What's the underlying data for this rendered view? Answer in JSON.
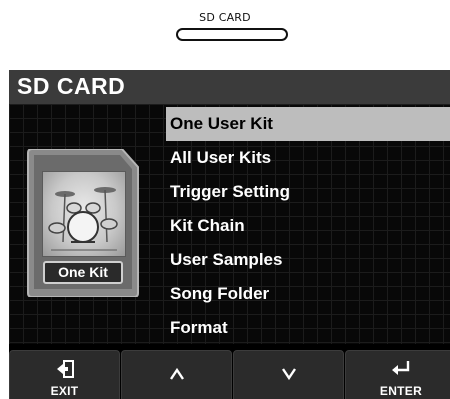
{
  "device": {
    "button_label": "SD CARD"
  },
  "screen": {
    "title": "SD CARD",
    "card_tag": "One Kit",
    "menu": [
      {
        "label": "One User Kit",
        "selected": true
      },
      {
        "label": "All User Kits",
        "selected": false
      },
      {
        "label": "Trigger Setting",
        "selected": false
      },
      {
        "label": "Kit Chain",
        "selected": false
      },
      {
        "label": "User Samples",
        "selected": false
      },
      {
        "label": "Song Folder",
        "selected": false
      },
      {
        "label": "Format",
        "selected": false
      }
    ],
    "footer": {
      "exit": {
        "label": "EXIT",
        "icon": "exit-icon"
      },
      "up": {
        "icon": "caret-up-icon"
      },
      "down": {
        "icon": "caret-down-icon"
      },
      "enter": {
        "label": "ENTER",
        "icon": "enter-icon"
      }
    }
  },
  "colors": {
    "screen_bg": "#000000",
    "title_bar": "#3b3b3b",
    "selection": "#bdbdbd",
    "text": "#ffffff"
  }
}
